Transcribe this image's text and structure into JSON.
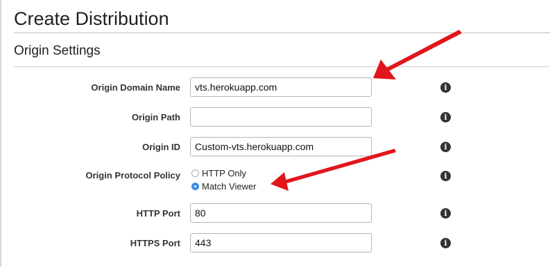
{
  "page": {
    "title": "Create Distribution"
  },
  "section": {
    "title": "Origin Settings"
  },
  "fields": {
    "origin_domain_name": {
      "label": "Origin Domain Name",
      "value": "vts.herokuapp.com",
      "info_icon": "info-icon"
    },
    "origin_path": {
      "label": "Origin Path",
      "value": "",
      "info_icon": "info-icon"
    },
    "origin_id": {
      "label": "Origin ID",
      "value": "Custom-vts.herokuapp.com",
      "info_icon": "info-icon"
    },
    "origin_protocol_policy": {
      "label": "Origin Protocol Policy",
      "options": [
        {
          "label": "HTTP Only",
          "selected": false
        },
        {
          "label": "Match Viewer",
          "selected": true
        }
      ],
      "info_icon": "info-icon"
    },
    "http_port": {
      "label": "HTTP Port",
      "value": "80",
      "info_icon": "info-icon"
    },
    "https_port": {
      "label": "HTTPS Port",
      "value": "443",
      "info_icon": "info-icon"
    }
  },
  "colors": {
    "annotation_arrow": "#e0161b",
    "radio_selected": "#3b8ee6",
    "info_icon": "#333333"
  }
}
